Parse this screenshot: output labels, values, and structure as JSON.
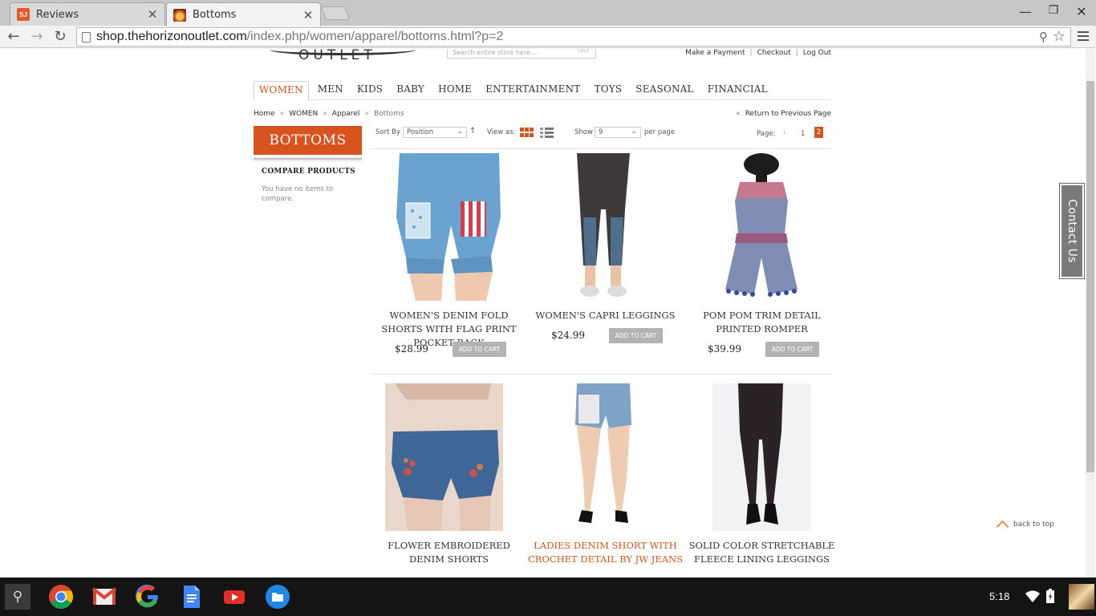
{
  "browser": {
    "tabs": [
      {
        "title": "Reviews",
        "favicon": "SJ",
        "active": false
      },
      {
        "title": "Bottoms",
        "favicon": "horizon-outlet",
        "active": true
      }
    ],
    "url_host": "shop.thehorizonoutlet.com",
    "url_path": "/index.php/women/apparel/bottoms.html?p=2"
  },
  "site": {
    "logo_text": "OUTLET",
    "search_placeholder": "Search entire store here...",
    "search_go": "GO",
    "top_links": [
      "Make a Payment",
      "Checkout",
      "Log Out"
    ],
    "nav": [
      "WOMEN",
      "MEN",
      "KIDS",
      "BABY",
      "HOME",
      "ENTERTAINMENT",
      "TOYS",
      "SEASONAL",
      "FINANCIAL"
    ],
    "active_nav": "WOMEN",
    "breadcrumb": [
      "Home",
      "WOMEN",
      "Apparel",
      "Bottoms"
    ],
    "breadcrumb_sep": "»",
    "return_link": "Return to Previous Page",
    "category_title": "BOTTOMS",
    "compare_title": "COMPARE PRODUCTS",
    "compare_text": "You have no items to compare."
  },
  "toolbar": {
    "sort_label": "Sort By",
    "sort_value": "Position",
    "view_label": "View as:",
    "show_label": "Show",
    "show_value": "9",
    "perpage_label": "per page",
    "page_label": "Page:",
    "pages": [
      "1",
      "2"
    ],
    "current_page": "2"
  },
  "products": [
    {
      "name": "WOMEN'S DENIM FOLD SHORTS WITH FLAG PRINT POCKET BACK",
      "price": "$28.99",
      "cart": "ADD TO CART"
    },
    {
      "name": "WOMEN'S CAPRI LEGGINGS",
      "price": "$24.99",
      "cart": "ADD TO CART"
    },
    {
      "name": "POM POM TRIM DETAIL PRINTED ROMPER",
      "price": "$39.99",
      "cart": "ADD TO CART"
    },
    {
      "name": "FLOWER EMBROIDERED DENIM SHORTS",
      "price": "",
      "cart": ""
    },
    {
      "name": "LADIES DENIM SHORT WITH CROCHET DETAIL BY JW JEANS",
      "price": "",
      "cart": ""
    },
    {
      "name": "SOLID COLOR STRETCHABLE FLEECE LINING LEGGINGS",
      "price": "",
      "cart": ""
    }
  ],
  "contact_tab": "Contact Us",
  "back_to_top": "back to top",
  "shelf": {
    "apps": [
      "chrome-icon",
      "gmail-icon",
      "google-icon",
      "docs-icon",
      "youtube-icon",
      "files-icon"
    ],
    "time": "5:18"
  },
  "colors": {
    "accent": "#d9531e",
    "cart_button": "#b3b3b3",
    "shelf": "#141414"
  }
}
